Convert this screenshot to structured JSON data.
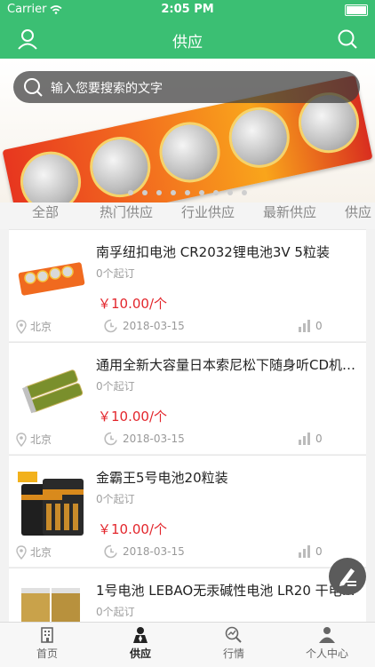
{
  "status": {
    "carrier": "Carrier",
    "time": "2:05 PM"
  },
  "navbar": {
    "title": "供应"
  },
  "search": {
    "placeholder": "输入您要搜索的文字"
  },
  "tabs": [
    "全部",
    "热门供应",
    "行业供应",
    "最新供应",
    "供应"
  ],
  "products": [
    {
      "title": "南孚纽扣电池 CR2032锂电池3V 5粒装",
      "moq": "0个起订",
      "price": "￥10.00/个",
      "location": "北京",
      "date": "2018-03-15",
      "views": "0"
    },
    {
      "title": "通用全新大容量日本索尼松下随身听CD机…",
      "moq": "0个起订",
      "price": "￥10.00/个",
      "location": "北京",
      "date": "2018-03-15",
      "views": "0"
    },
    {
      "title": "金霸王5号电池20粒装",
      "moq": "0个起订",
      "price": "￥10.00/个",
      "location": "北京",
      "date": "2018-03-15",
      "views": "0"
    },
    {
      "title": "1号电池 LEBAO无汞碱性电池 LR20 干电…",
      "moq": "0个起订",
      "price": "",
      "location": "",
      "date": "",
      "views": ""
    }
  ],
  "tabbar": [
    "首页",
    "供应",
    "行情",
    "个人中心"
  ],
  "colors": {
    "brand": "#3bbf73",
    "price": "#e3262c"
  }
}
